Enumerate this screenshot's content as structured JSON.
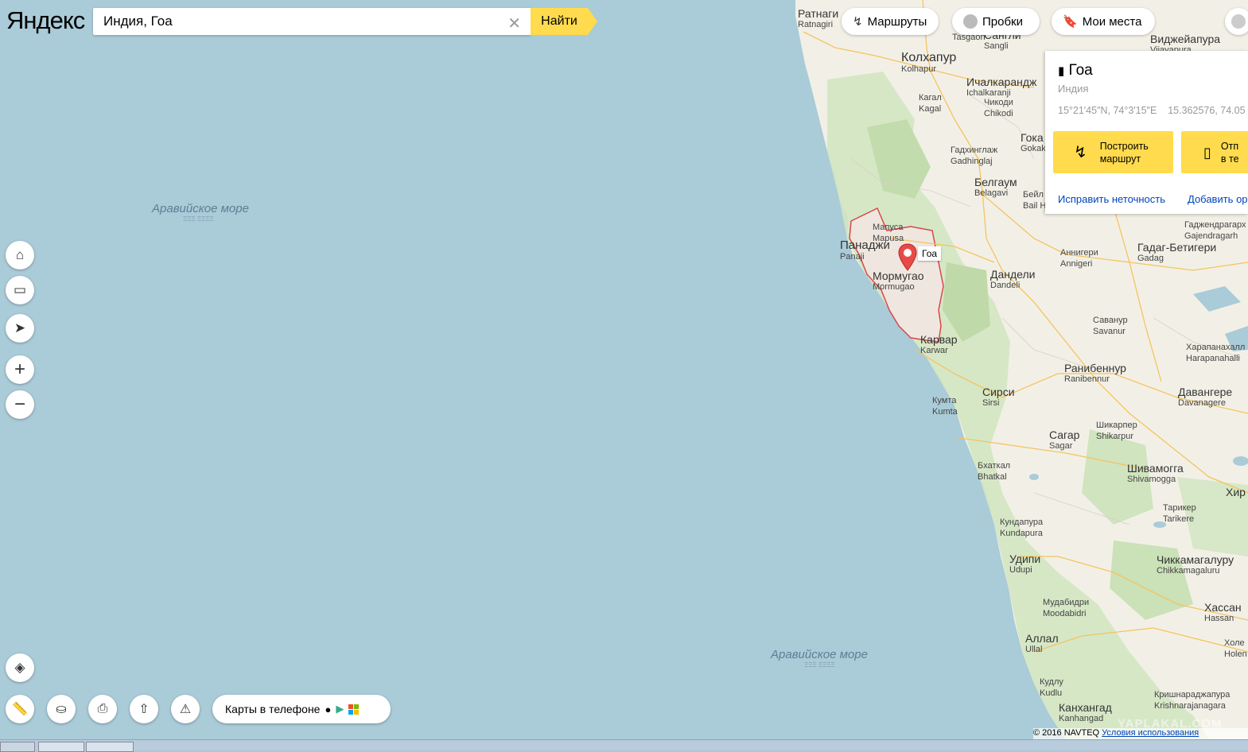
{
  "search": {
    "logo_brand": "Яндекс",
    "query": "Индия, Гоа",
    "button_label": "Найти"
  },
  "top_nav": {
    "routes_label": "Маршруты",
    "traffic_label": "Пробки",
    "my_places_label": "Мои места"
  },
  "card": {
    "title": "Гоа",
    "subtitle": "Индия",
    "coords_dms": "15°21′45″N, 74°3′15″E",
    "coords_decimal": "15.362576, 74.05",
    "route_button": "Построить маршрут",
    "send_button": "Отп в те",
    "fix_link": "Исправить неточность",
    "add_link": "Добавить ор"
  },
  "bottom": {
    "phone_label": "Карты в телефоне",
    "copyright": "© 2016 NAVTEQ",
    "terms": "Условия использования",
    "watermark": "YAPLAKAL.COM"
  },
  "marker_label": "Гоа",
  "seas": [
    {
      "name": "Аравийское море",
      "sub": "ΞΞΞ ΞΞΞΞ"
    },
    {
      "name": "Аравийское море",
      "sub": "ΞΞΞ ΞΞΞΞ"
    }
  ],
  "cities": [
    {
      "ru": "Ратнаги",
      "en": "Ratnagiri"
    },
    {
      "ru": "Сангли",
      "en": "Sangli"
    },
    {
      "ru": "Tasgaon",
      "en": ""
    },
    {
      "ru": "Виджейапура",
      "en": "Vijayapura"
    },
    {
      "ru": "Колхапур",
      "en": "Kolhapur"
    },
    {
      "ru": "Ичалкарандж",
      "en": "Ichalkaranji"
    },
    {
      "ru": "Кагал",
      "en": "Kagal"
    },
    {
      "ru": "Чикоди",
      "en": "Chikodi"
    },
    {
      "ru": "Гадхинглаж",
      "en": "Gadhinglaj"
    },
    {
      "ru": "Гока",
      "en": "Gokak"
    },
    {
      "ru": "Белгаум",
      "en": "Belagavi"
    },
    {
      "ru": "Бейл",
      "en": "Bail H"
    },
    {
      "ru": "Мапуса",
      "en": "Mapusa"
    },
    {
      "ru": "Панаджи",
      "en": "Panaji"
    },
    {
      "ru": "Мормугао",
      "en": "Mormugao"
    },
    {
      "ru": "Дандели",
      "en": "Dandeli"
    },
    {
      "ru": "Аннигери",
      "en": "Annigeri"
    },
    {
      "ru": "Гадаг-Бетигери",
      "en": "Gadag"
    },
    {
      "ru": "Гаджендрагарх",
      "en": "Gajendragarh"
    },
    {
      "ru": "Карвар",
      "en": "Karwar"
    },
    {
      "ru": "Саванур",
      "en": "Savanur"
    },
    {
      "ru": "Харапанахалл",
      "en": "Harapanahalli"
    },
    {
      "ru": "Ранибеннур",
      "en": "Ranibennur"
    },
    {
      "ru": "Сирси",
      "en": "Sirsi"
    },
    {
      "ru": "Давангере",
      "en": "Davanagere"
    },
    {
      "ru": "Кумта",
      "en": "Kumta"
    },
    {
      "ru": "Шикарпер",
      "en": "Shikarpur"
    },
    {
      "ru": "Сагар",
      "en": "Sagar"
    },
    {
      "ru": "Бхаткал",
      "en": "Bhatkal"
    },
    {
      "ru": "Шивамогга",
      "en": "Shivamogga"
    },
    {
      "ru": "Хир",
      "en": ""
    },
    {
      "ru": "Тарикер",
      "en": "Tarikere"
    },
    {
      "ru": "Кундапура",
      "en": "Kundapura"
    },
    {
      "ru": "Удипи",
      "en": "Udupi"
    },
    {
      "ru": "Чиккамагалуру",
      "en": "Chikkamagaluru"
    },
    {
      "ru": "Мудабидри",
      "en": "Moodabidri"
    },
    {
      "ru": "Хассан",
      "en": "Hassan"
    },
    {
      "ru": "Аллал",
      "en": "Ullal"
    },
    {
      "ru": "Холе",
      "en": "Holen"
    },
    {
      "ru": "Кудлу",
      "en": "Kudlu"
    },
    {
      "ru": "Кришнараджапура",
      "en": "Krishnarajanagara"
    },
    {
      "ru": "Канхангад",
      "en": "Kanhangad"
    }
  ],
  "colors": {
    "sea": "#aacbd8",
    "land": "#f2f0e6",
    "forest": "#cfe2bd",
    "accent_yellow": "#ffdb4d",
    "goa_border": "#d8474b"
  }
}
